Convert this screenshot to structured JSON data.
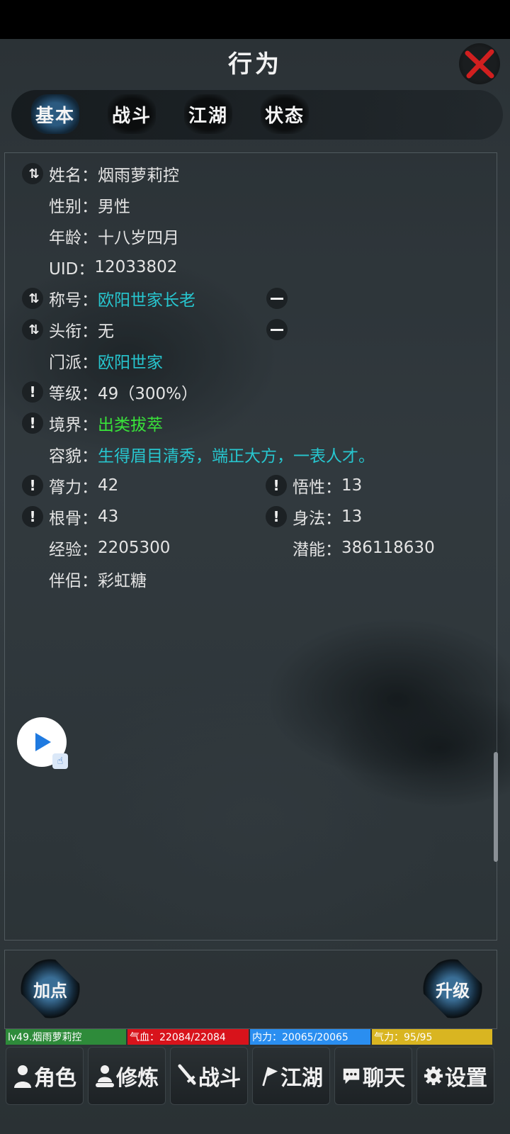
{
  "header": {
    "title": "行为"
  },
  "tabs": [
    {
      "label": "基本",
      "active": true
    },
    {
      "label": "战斗",
      "active": false
    },
    {
      "label": "江湖",
      "active": false
    },
    {
      "label": "状态",
      "active": false
    }
  ],
  "profile": {
    "name": {
      "key": "姓名：",
      "value": "烟雨萝莉控"
    },
    "gender": {
      "key": "性别：",
      "value": "男性"
    },
    "age": {
      "key": "年龄：",
      "value": "十八岁四月"
    },
    "uid": {
      "key": "UID：",
      "value": "12033802"
    },
    "title": {
      "key": "称号：",
      "value": "欧阳世家长老"
    },
    "rank": {
      "key": "头衔：",
      "value": "无"
    },
    "sect": {
      "key": "门派：",
      "value": "欧阳世家"
    },
    "level": {
      "key": "等级：",
      "value": "49（300%）"
    },
    "realm": {
      "key": "境界：",
      "value": "出类拔萃"
    },
    "looks": {
      "key": "容貌：",
      "value": "生得眉目清秀，端正大方，一表人才。"
    },
    "strength": {
      "key": "膂力：",
      "value": "42"
    },
    "wisdom": {
      "key": "悟性：",
      "value": "13"
    },
    "constitution": {
      "key": "根骨：",
      "value": "43"
    },
    "agility": {
      "key": "身法：",
      "value": "13"
    },
    "exp": {
      "key": "经验：",
      "value": "2205300"
    },
    "potential": {
      "key": "潜能：",
      "value": "386118630"
    },
    "partner": {
      "key": "伴侣：",
      "value": "彩虹糖"
    }
  },
  "actions": {
    "add_points": "加点",
    "upgrade": "升级"
  },
  "status_bar": {
    "name": "lv49.烟雨萝莉控",
    "hp": "气血：22084/22084",
    "mp": "内力：20065/20065",
    "stamina": "气力：95/95",
    "colors": {
      "name": "#2e8b3a",
      "hp": "#d8131b",
      "mp": "#2a8ef0",
      "stamina": "#d9b521"
    }
  },
  "nav": [
    {
      "label": "角色",
      "icon": "person-icon"
    },
    {
      "label": "修炼",
      "icon": "meditate-icon"
    },
    {
      "label": "战斗",
      "icon": "sword-icon"
    },
    {
      "label": "江湖",
      "icon": "flag-icon"
    },
    {
      "label": "聊天",
      "icon": "chat-icon"
    },
    {
      "label": "设置",
      "icon": "gear-icon"
    }
  ]
}
